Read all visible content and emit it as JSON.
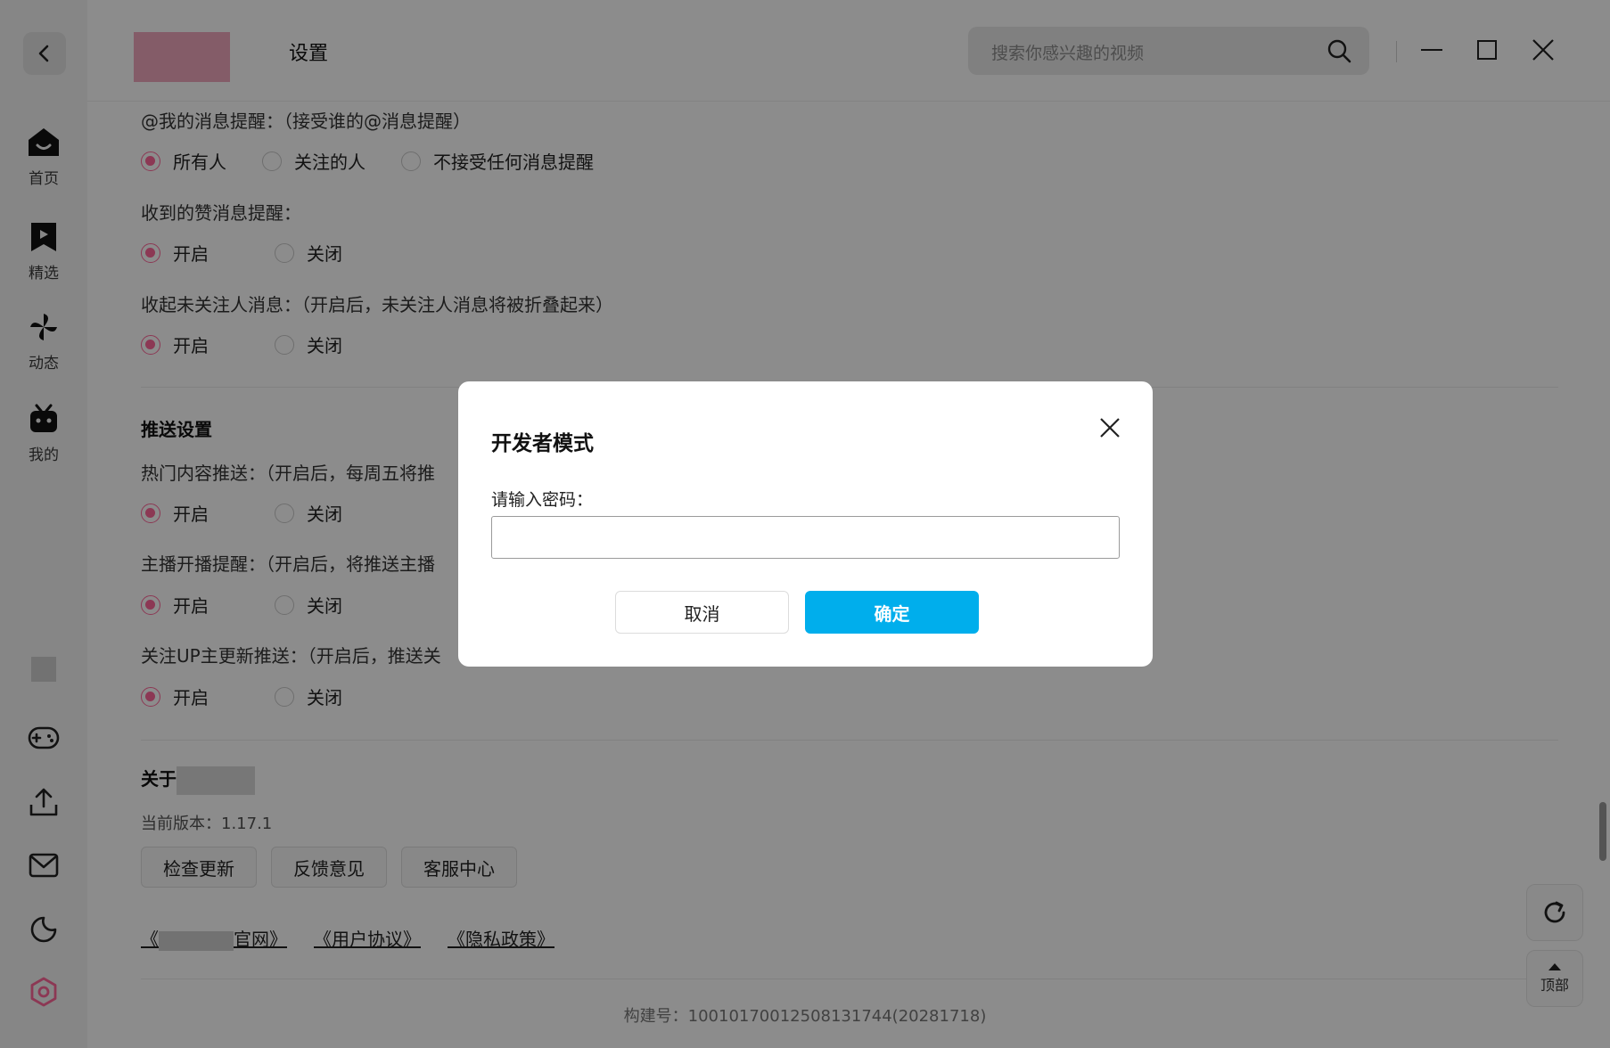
{
  "header": {
    "title": "设置",
    "search_placeholder": "搜索你感兴趣的视频"
  },
  "sidebar": {
    "items": [
      {
        "label": "首页",
        "icon": "home-icon"
      },
      {
        "label": "精选",
        "icon": "bookmark-play-icon"
      },
      {
        "label": "动态",
        "icon": "pinwheel-icon"
      },
      {
        "label": "我的",
        "icon": "tv-mascot-icon"
      }
    ],
    "tools": [
      "thumbnail",
      "gamepad-icon",
      "upload-icon",
      "mail-icon",
      "moon-icon",
      "settings-icon"
    ]
  },
  "settings": {
    "at_reminder": {
      "question": "@我的消息提醒：（接受谁的@消息提醒）",
      "options": [
        "所有人",
        "关注的人",
        "不接受任何消息提醒"
      ],
      "selected": 0
    },
    "like_reminder": {
      "question": "收到的赞消息提醒：",
      "options": [
        "开启",
        "关闭"
      ],
      "selected": 0
    },
    "fold_unfollowed": {
      "question": "收起未关注人消息：（开启后，未关注人消息将被折叠起来）",
      "options": [
        "开启",
        "关闭"
      ],
      "selected": 0
    },
    "push_section_title": "推送设置",
    "hot_push": {
      "question": "热门内容推送：（开启后，每周五将推",
      "options": [
        "开启",
        "关闭"
      ],
      "selected": 0
    },
    "live_push": {
      "question": "主播开播提醒：（开启后，将推送主播",
      "options": [
        "开启",
        "关闭"
      ],
      "selected": 0
    },
    "up_push": {
      "question": "关注UP主更新推送：（开启后，推送关",
      "options": [
        "开启",
        "关闭"
      ],
      "selected": 0
    },
    "about_title": "关于",
    "version": "当前版本：1.17.1",
    "buttons": [
      "检查更新",
      "反馈意见",
      "客服中心"
    ],
    "links": {
      "official_pre": "《",
      "official_post": "官网》",
      "agreement": "《用户协议》",
      "privacy": "《隐私政策》"
    },
    "build": "构建号：10010170012508131744(20281718)"
  },
  "fab": {
    "top_label": "顶部"
  },
  "dialog": {
    "title": "开发者模式",
    "label": "请输入密码：",
    "input_value": "",
    "cancel": "取消",
    "ok": "确定"
  },
  "colors": {
    "accent_pink": "#ff6699",
    "primary_blue": "#00aeec"
  }
}
